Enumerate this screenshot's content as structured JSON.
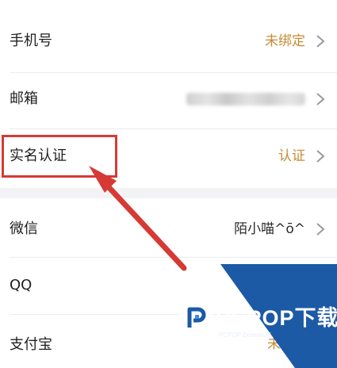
{
  "rows_top": [
    {
      "label": "手机号",
      "value": "未绑定",
      "value_style": "accent"
    },
    {
      "label": "邮箱",
      "value": "",
      "value_style": "masked"
    },
    {
      "label": "实名认证",
      "value": "认证",
      "value_style": "accent"
    }
  ],
  "rows_bottom": [
    {
      "label": "微信",
      "value": "陌小喵^ō^",
      "value_style": "dark"
    },
    {
      "label": "QQ",
      "value": "",
      "value_style": "none"
    },
    {
      "label": "支付宝",
      "value": "未绑",
      "value_style": "accent"
    }
  ],
  "icons": {
    "row_chevron": "chevron-right-icon",
    "watermark_logo": "pcpop-logo-icon"
  },
  "watermark": {
    "brand": "PCPOP下载",
    "tagline": "PCPOP Download"
  },
  "colors": {
    "accent": "#c98a35",
    "highlight": "#d63a35",
    "watermark_blue": "#1c5aa6",
    "page_background": "#f3f3f5"
  }
}
